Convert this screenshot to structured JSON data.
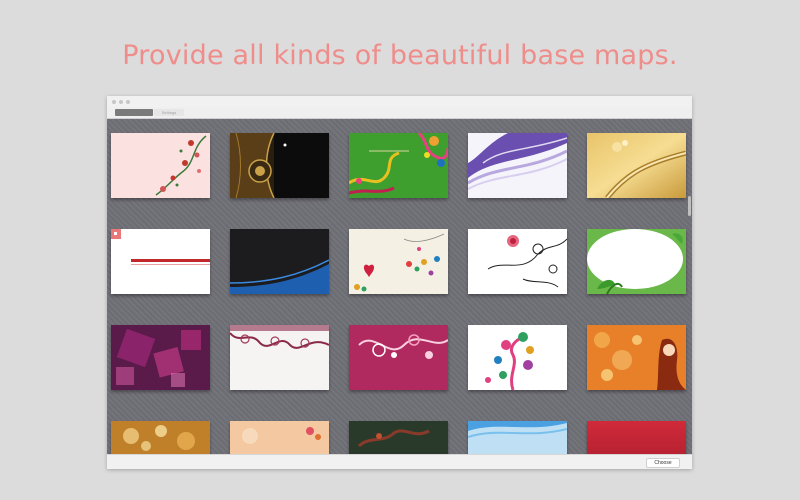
{
  "headline": "Provide all kinds of beautiful base maps.",
  "window": {
    "tabs": [
      {
        "label": "Builtin",
        "active": true
      },
      {
        "label": "Settings",
        "active": false
      }
    ],
    "choose_label": "Choose"
  },
  "colors": {
    "headline": "#ef8d8b",
    "grid_background": "#707077"
  },
  "gallery": [
    {
      "icon": "light-pink-floral-corner"
    },
    {
      "icon": "black-gold-ornate"
    },
    {
      "icon": "green-colorful-swirl"
    },
    {
      "icon": "purple-wave"
    },
    {
      "icon": "gold-ribbon"
    },
    {
      "icon": "white-red-line"
    },
    {
      "icon": "black-blue-curve"
    },
    {
      "icon": "cream-hearts-dots"
    },
    {
      "icon": "white-sketch-roses"
    },
    {
      "icon": "white-green-leaves"
    },
    {
      "icon": "magenta-squares"
    },
    {
      "icon": "white-lace-border"
    },
    {
      "icon": "magenta-swirls"
    },
    {
      "icon": "white-colorful-tree"
    },
    {
      "icon": "orange-bokeh-lady"
    },
    {
      "icon": "gold-bokeh"
    },
    {
      "icon": "peach-floral"
    },
    {
      "icon": "dark-green-splash"
    },
    {
      "icon": "light-blue-wave"
    },
    {
      "icon": "red-gradient"
    }
  ]
}
